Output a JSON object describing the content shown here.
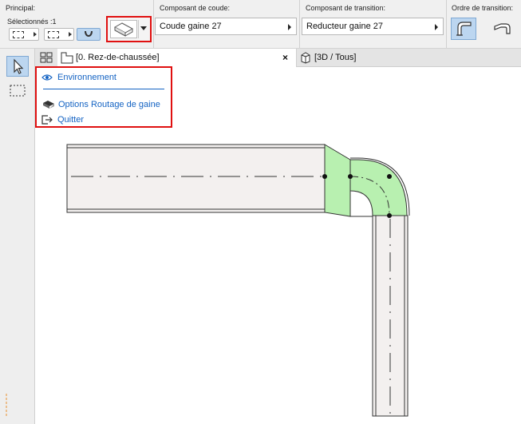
{
  "toolbar": {
    "principal_label": "Principal:",
    "selected_count": "Sélectionnés :1",
    "elbow_label": "Composant de coude:",
    "elbow_value": "Coude gaine 27",
    "transition_label": "Composant de transition:",
    "transition_value": "Reducteur gaine 27",
    "order_label": "Ordre de transition:"
  },
  "tabs": [
    {
      "label": "[0. Rez-de-chaussée]",
      "close": "×"
    },
    {
      "label": "[3D / Tous]"
    }
  ],
  "menu": {
    "items": [
      {
        "label": "Environnement",
        "icon": "eye-icon"
      },
      {
        "label": "Options Routage de gaine",
        "icon": "duct-settings-icon"
      },
      {
        "label": "Quitter",
        "icon": "exit-icon"
      }
    ]
  },
  "colors": {
    "highlight_red": "#e01010",
    "link_blue": "#1463c3",
    "duct_fill": "#f3f0ef",
    "fitting_fill": "#b8f0b0",
    "active_bg": "#bcd6f0"
  }
}
